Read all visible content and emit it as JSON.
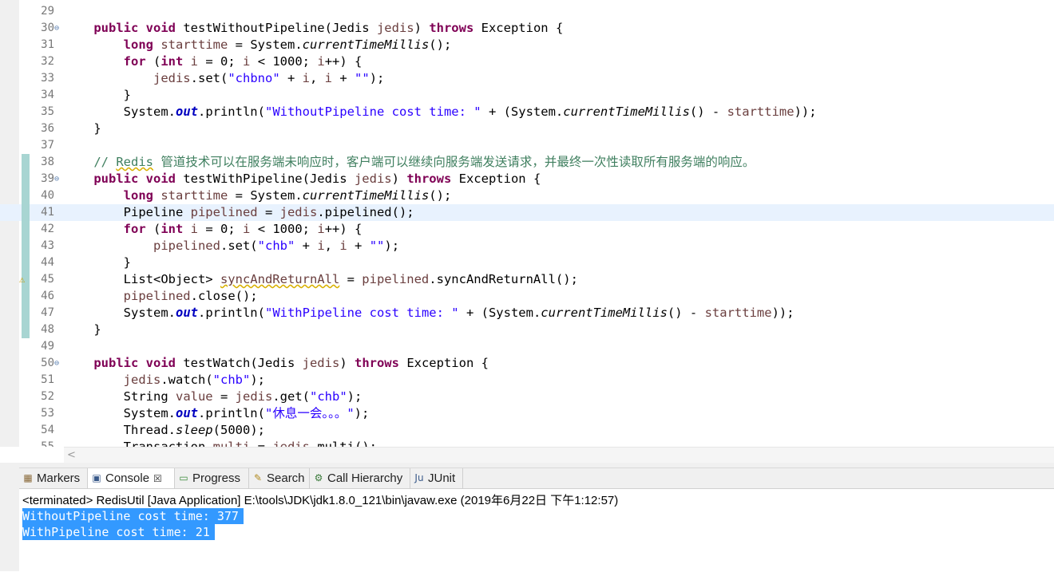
{
  "editor": {
    "lines": [
      {
        "n": "29",
        "fold": "",
        "diff": false,
        "warn": false,
        "current": false,
        "tokens": []
      },
      {
        "n": "30",
        "fold": "⊖",
        "diff": false,
        "warn": false,
        "current": false,
        "tokens": [
          [
            "    ",
            ""
          ],
          [
            "public",
            "kw"
          ],
          [
            " ",
            ""
          ],
          [
            "void",
            "kw"
          ],
          [
            " testWithoutPipeline(Jedis ",
            ""
          ],
          [
            "jedis",
            "var"
          ],
          [
            ") ",
            ""
          ],
          [
            "throws",
            "kw"
          ],
          [
            " Exception {",
            ""
          ]
        ]
      },
      {
        "n": "31",
        "fold": "",
        "diff": false,
        "warn": false,
        "current": false,
        "tokens": [
          [
            "        ",
            ""
          ],
          [
            "long",
            "kw"
          ],
          [
            " ",
            ""
          ],
          [
            "starttime",
            "var"
          ],
          [
            " = System.",
            ""
          ],
          [
            "currentTimeMillis",
            "stat"
          ],
          [
            "();",
            ""
          ]
        ]
      },
      {
        "n": "32",
        "fold": "",
        "diff": false,
        "warn": false,
        "current": false,
        "tokens": [
          [
            "        ",
            ""
          ],
          [
            "for",
            "kw"
          ],
          [
            " (",
            ""
          ],
          [
            "int",
            "kw"
          ],
          [
            " ",
            ""
          ],
          [
            "i",
            "var"
          ],
          [
            " = 0; ",
            ""
          ],
          [
            "i",
            "var"
          ],
          [
            " < 1000; ",
            ""
          ],
          [
            "i",
            "var"
          ],
          [
            "++) {",
            ""
          ]
        ]
      },
      {
        "n": "33",
        "fold": "",
        "diff": false,
        "warn": false,
        "current": false,
        "tokens": [
          [
            "            ",
            ""
          ],
          [
            "jedis",
            "var"
          ],
          [
            ".set(",
            ""
          ],
          [
            "\"chbno\"",
            "str"
          ],
          [
            " + ",
            ""
          ],
          [
            "i",
            "var"
          ],
          [
            ", ",
            ""
          ],
          [
            "i",
            "var"
          ],
          [
            " + ",
            ""
          ],
          [
            "\"\"",
            "str"
          ],
          [
            ");",
            ""
          ]
        ]
      },
      {
        "n": "34",
        "fold": "",
        "diff": false,
        "warn": false,
        "current": false,
        "tokens": [
          [
            "        }",
            ""
          ]
        ]
      },
      {
        "n": "35",
        "fold": "",
        "diff": false,
        "warn": false,
        "current": false,
        "tokens": [
          [
            "        System.",
            ""
          ],
          [
            "out",
            "field"
          ],
          [
            ".println(",
            ""
          ],
          [
            "\"WithoutPipeline cost time: \"",
            "str"
          ],
          [
            " + (System.",
            ""
          ],
          [
            "currentTimeMillis",
            "stat"
          ],
          [
            "() - ",
            ""
          ],
          [
            "starttime",
            "var"
          ],
          [
            "));",
            ""
          ]
        ]
      },
      {
        "n": "36",
        "fold": "",
        "diff": false,
        "warn": false,
        "current": false,
        "tokens": [
          [
            "    }",
            ""
          ]
        ]
      },
      {
        "n": "37",
        "fold": "",
        "diff": false,
        "warn": false,
        "current": false,
        "tokens": []
      },
      {
        "n": "38",
        "fold": "",
        "diff": true,
        "warn": false,
        "current": false,
        "tokens": [
          [
            "    // ",
            "cmt"
          ],
          [
            "Redis",
            "cmt sq"
          ],
          [
            " 管道技术可以在服务端未响应时，客户端可以继续向服务端发送请求，并最终一次性读取所有服务端的响应。",
            "cmt"
          ]
        ]
      },
      {
        "n": "39",
        "fold": "⊖",
        "diff": true,
        "warn": false,
        "current": false,
        "tokens": [
          [
            "    ",
            ""
          ],
          [
            "public",
            "kw"
          ],
          [
            " ",
            ""
          ],
          [
            "void",
            "kw"
          ],
          [
            " testWithPipeline(Jedis ",
            ""
          ],
          [
            "jedis",
            "var"
          ],
          [
            ") ",
            ""
          ],
          [
            "throws",
            "kw"
          ],
          [
            " Exception {",
            ""
          ]
        ]
      },
      {
        "n": "40",
        "fold": "",
        "diff": true,
        "warn": false,
        "current": false,
        "tokens": [
          [
            "        ",
            ""
          ],
          [
            "long",
            "kw"
          ],
          [
            " ",
            ""
          ],
          [
            "starttime",
            "var"
          ],
          [
            " = System.",
            ""
          ],
          [
            "currentTimeMillis",
            "stat"
          ],
          [
            "();",
            ""
          ]
        ]
      },
      {
        "n": "41",
        "fold": "",
        "diff": true,
        "warn": false,
        "current": true,
        "tokens": [
          [
            "        Pipeline ",
            ""
          ],
          [
            "pipelined",
            "var"
          ],
          [
            " = ",
            ""
          ],
          [
            "jedis",
            "var"
          ],
          [
            ".pipelined();",
            ""
          ]
        ]
      },
      {
        "n": "42",
        "fold": "",
        "diff": true,
        "warn": false,
        "current": false,
        "tokens": [
          [
            "        ",
            ""
          ],
          [
            "for",
            "kw"
          ],
          [
            " (",
            ""
          ],
          [
            "int",
            "kw"
          ],
          [
            " ",
            ""
          ],
          [
            "i",
            "var"
          ],
          [
            " = 0; ",
            ""
          ],
          [
            "i",
            "var"
          ],
          [
            " < 1000; ",
            ""
          ],
          [
            "i",
            "var"
          ],
          [
            "++) {",
            ""
          ]
        ]
      },
      {
        "n": "43",
        "fold": "",
        "diff": true,
        "warn": false,
        "current": false,
        "tokens": [
          [
            "            ",
            ""
          ],
          [
            "pipelined",
            "var"
          ],
          [
            ".set(",
            ""
          ],
          [
            "\"chb\"",
            "str"
          ],
          [
            " + ",
            ""
          ],
          [
            "i",
            "var"
          ],
          [
            ", ",
            ""
          ],
          [
            "i",
            "var"
          ],
          [
            " + ",
            ""
          ],
          [
            "\"\"",
            "str"
          ],
          [
            ");",
            ""
          ]
        ]
      },
      {
        "n": "44",
        "fold": "",
        "diff": true,
        "warn": false,
        "current": false,
        "tokens": [
          [
            "        }",
            ""
          ]
        ]
      },
      {
        "n": "45",
        "fold": "",
        "diff": true,
        "warn": true,
        "current": false,
        "tokens": [
          [
            "        List<Object> ",
            ""
          ],
          [
            "syncAndReturnAll",
            "var sq"
          ],
          [
            " = ",
            ""
          ],
          [
            "pipelined",
            "var"
          ],
          [
            ".syncAndReturnAll();",
            ""
          ]
        ]
      },
      {
        "n": "46",
        "fold": "",
        "diff": true,
        "warn": false,
        "current": false,
        "tokens": [
          [
            "        ",
            ""
          ],
          [
            "pipelined",
            "var"
          ],
          [
            ".close();",
            ""
          ]
        ]
      },
      {
        "n": "47",
        "fold": "",
        "diff": true,
        "warn": false,
        "current": false,
        "tokens": [
          [
            "        System.",
            ""
          ],
          [
            "out",
            "field"
          ],
          [
            ".println(",
            ""
          ],
          [
            "\"WithPipeline cost time: \"",
            "str"
          ],
          [
            " + (System.",
            ""
          ],
          [
            "currentTimeMillis",
            "stat"
          ],
          [
            "() - ",
            ""
          ],
          [
            "starttime",
            "var"
          ],
          [
            "));",
            ""
          ]
        ]
      },
      {
        "n": "48",
        "fold": "",
        "diff": true,
        "warn": false,
        "current": false,
        "tokens": [
          [
            "    }",
            ""
          ]
        ]
      },
      {
        "n": "49",
        "fold": "",
        "diff": false,
        "warn": false,
        "current": false,
        "tokens": []
      },
      {
        "n": "50",
        "fold": "⊖",
        "diff": false,
        "warn": false,
        "current": false,
        "tokens": [
          [
            "    ",
            ""
          ],
          [
            "public",
            "kw"
          ],
          [
            " ",
            ""
          ],
          [
            "void",
            "kw"
          ],
          [
            " testWatch(Jedis ",
            ""
          ],
          [
            "jedis",
            "var"
          ],
          [
            ") ",
            ""
          ],
          [
            "throws",
            "kw"
          ],
          [
            " Exception {",
            ""
          ]
        ]
      },
      {
        "n": "51",
        "fold": "",
        "diff": false,
        "warn": false,
        "current": false,
        "tokens": [
          [
            "        ",
            ""
          ],
          [
            "jedis",
            "var"
          ],
          [
            ".watch(",
            ""
          ],
          [
            "\"chb\"",
            "str"
          ],
          [
            ");",
            ""
          ]
        ]
      },
      {
        "n": "52",
        "fold": "",
        "diff": false,
        "warn": false,
        "current": false,
        "tokens": [
          [
            "        String ",
            ""
          ],
          [
            "value",
            "var"
          ],
          [
            " = ",
            ""
          ],
          [
            "jedis",
            "var"
          ],
          [
            ".get(",
            ""
          ],
          [
            "\"chb\"",
            "str"
          ],
          [
            ");",
            ""
          ]
        ]
      },
      {
        "n": "53",
        "fold": "",
        "diff": false,
        "warn": false,
        "current": false,
        "tokens": [
          [
            "        System.",
            ""
          ],
          [
            "out",
            "field"
          ],
          [
            ".println(",
            ""
          ],
          [
            "\"休息一会。。。\"",
            "str"
          ],
          [
            ");",
            ""
          ]
        ]
      },
      {
        "n": "54",
        "fold": "",
        "diff": false,
        "warn": false,
        "current": false,
        "tokens": [
          [
            "        Thread.",
            ""
          ],
          [
            "sleep",
            "stat"
          ],
          [
            "(5000);",
            ""
          ]
        ]
      },
      {
        "n": "55",
        "fold": "",
        "diff": false,
        "warn": false,
        "current": false,
        "tokens": [
          [
            "        Transaction ",
            ""
          ],
          [
            "multi",
            "var"
          ],
          [
            " = ",
            ""
          ],
          [
            "jedis",
            "var"
          ],
          [
            ".multi();",
            ""
          ]
        ]
      }
    ]
  },
  "hscroll": {
    "left_arrow": "<"
  },
  "tabs": [
    {
      "label": "Markers",
      "icon": "markers-icon",
      "glyph": "▦",
      "active": false
    },
    {
      "label": "Console",
      "icon": "console-icon",
      "glyph": "▣",
      "active": true,
      "close": "☒"
    },
    {
      "label": "Progress",
      "icon": "progress-icon",
      "glyph": "▭",
      "active": false
    },
    {
      "label": "Search",
      "icon": "search-icon",
      "glyph": "✎",
      "active": false
    },
    {
      "label": "Call Hierarchy",
      "icon": "call-hierarchy-icon",
      "glyph": "⚙",
      "active": false
    },
    {
      "label": "JUnit",
      "icon": "junit-icon",
      "glyph": "Ju",
      "active": false
    }
  ],
  "console": {
    "status": "<terminated> RedisUtil [Java Application] E:\\tools\\JDK\\jdk1.8.0_121\\bin\\javaw.exe (2019年6月22日 下午1:12:57)",
    "output": [
      "WithoutPipeline cost time: 377",
      "WithPipeline cost time: 21"
    ]
  },
  "colors": {
    "keyword": "#7f0055",
    "string": "#2a00ff",
    "variable": "#6a3e3e",
    "comment": "#3f7f5f",
    "field": "#0000c0",
    "selection": "#3399ff",
    "current_line": "#e8f2fe",
    "diff_bar": "#a8d5d2"
  }
}
